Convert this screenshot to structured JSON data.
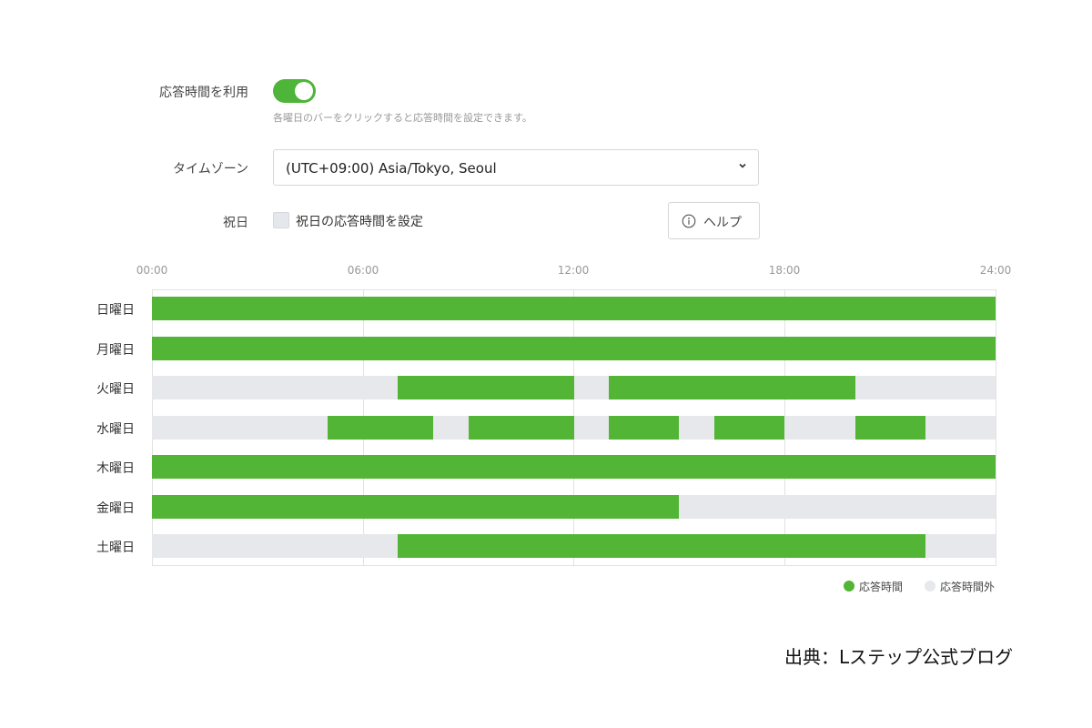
{
  "settings": {
    "response_time_label": "応答時間を利用",
    "toggle_on": true,
    "hint": "各曜日のバーをクリックすると応答時間を設定できます。",
    "timezone_label": "タイムゾーン",
    "timezone_value": "(UTC+09:00) Asia/Tokyo, Seoul",
    "holiday_label": "祝日",
    "holiday_checkbox_label": "祝日の応答時間を設定",
    "holiday_checked": false,
    "help_label": "ヘルプ"
  },
  "schedule": {
    "ticks": [
      "00:00",
      "06:00",
      "12:00",
      "18:00",
      "24:00"
    ],
    "days": [
      {
        "label": "日曜日",
        "ranges": [
          [
            0,
            24
          ]
        ]
      },
      {
        "label": "月曜日",
        "ranges": [
          [
            0,
            24
          ]
        ]
      },
      {
        "label": "火曜日",
        "ranges": [
          [
            7,
            12
          ],
          [
            13,
            20
          ]
        ]
      },
      {
        "label": "水曜日",
        "ranges": [
          [
            5,
            8
          ],
          [
            9,
            12
          ],
          [
            13,
            15
          ],
          [
            16,
            18
          ],
          [
            20,
            22
          ]
        ]
      },
      {
        "label": "木曜日",
        "ranges": [
          [
            0,
            24
          ]
        ]
      },
      {
        "label": "金曜日",
        "ranges": [
          [
            0,
            15
          ]
        ]
      },
      {
        "label": "土曜日",
        "ranges": [
          [
            7,
            22
          ]
        ]
      }
    ],
    "legend": {
      "on_label": "応答時間",
      "off_label": "応答時間外",
      "on_color": "#52b535",
      "off_color": "#e6e8eb"
    }
  },
  "source": "出典：Lステップ公式ブログ"
}
